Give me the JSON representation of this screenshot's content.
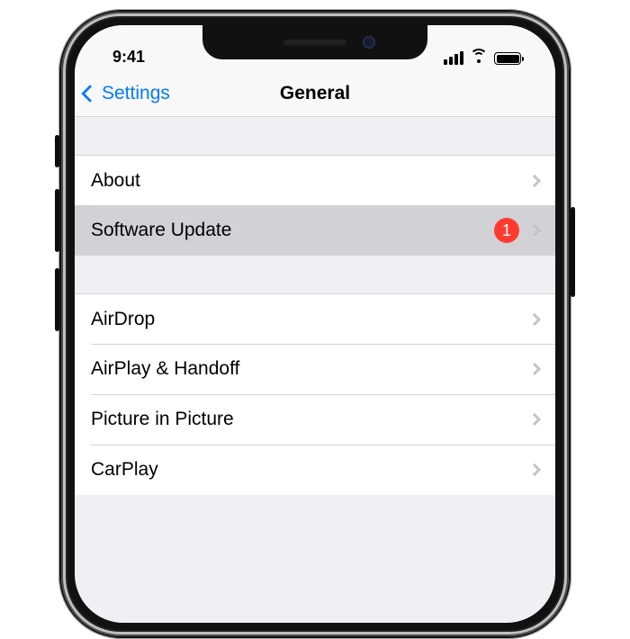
{
  "status_bar": {
    "time": "9:41"
  },
  "nav": {
    "back_label": "Settings",
    "title": "General"
  },
  "groups": [
    {
      "rows": [
        {
          "label": "About",
          "badge": null,
          "selected": false
        },
        {
          "label": "Software Update",
          "badge": "1",
          "selected": true
        }
      ]
    },
    {
      "rows": [
        {
          "label": "AirDrop",
          "badge": null,
          "selected": false
        },
        {
          "label": "AirPlay & Handoff",
          "badge": null,
          "selected": false
        },
        {
          "label": "Picture in Picture",
          "badge": null,
          "selected": false
        },
        {
          "label": "CarPlay",
          "badge": null,
          "selected": false
        }
      ]
    }
  ],
  "colors": {
    "accent": "#007aff",
    "badge": "#ff3b30",
    "group_bg": "#efeff4",
    "separator": "#d5d5d8"
  }
}
